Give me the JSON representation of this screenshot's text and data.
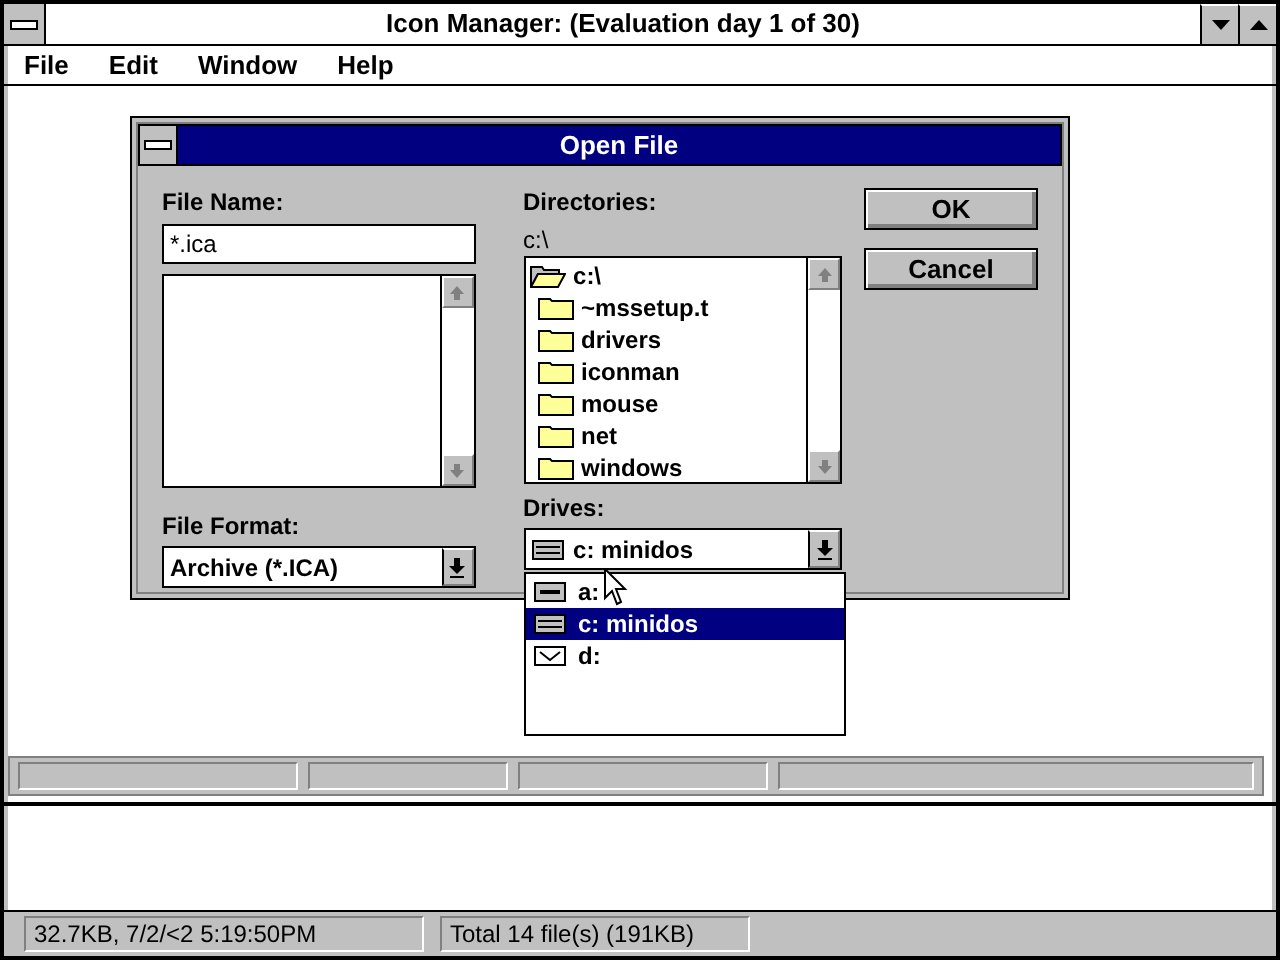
{
  "window": {
    "title": "Icon Manager: (Evaluation day 1 of 30)"
  },
  "menu": [
    "File",
    "Edit",
    "Window",
    "Help"
  ],
  "dialog": {
    "title": "Open File",
    "file_name_label": "File Name:",
    "file_name": "*.ica",
    "file_format_label": "File Format:",
    "file_format": "Archive (*.ICA)",
    "directories_label": "Directories:",
    "current_directory": "c:\\",
    "directories": [
      {
        "name": "c:\\",
        "kind": "open",
        "children": [
          {
            "name": "~mssetup.t",
            "kind": "folder"
          },
          {
            "name": "drivers",
            "kind": "folder"
          },
          {
            "name": "iconman",
            "kind": "folder"
          },
          {
            "name": "mouse",
            "kind": "folder"
          },
          {
            "name": "net",
            "kind": "folder"
          },
          {
            "name": "windows",
            "kind": "folder"
          }
        ]
      }
    ],
    "drives_label": "Drives:",
    "drive": {
      "name": "c: minidos",
      "kind": "hard"
    },
    "drive_list": [
      {
        "name": "a:",
        "kind": "floppy",
        "selected": false
      },
      {
        "name": "c: minidos",
        "kind": "hard",
        "selected": true
      },
      {
        "name": "d:",
        "kind": "cd",
        "selected": false
      }
    ],
    "buttons": [
      "OK",
      "Cancel"
    ]
  },
  "status_bar": [
    "32.7KB, 7/2/<2 5:19:50PM",
    "Total 14 file(s) (191KB)"
  ]
}
